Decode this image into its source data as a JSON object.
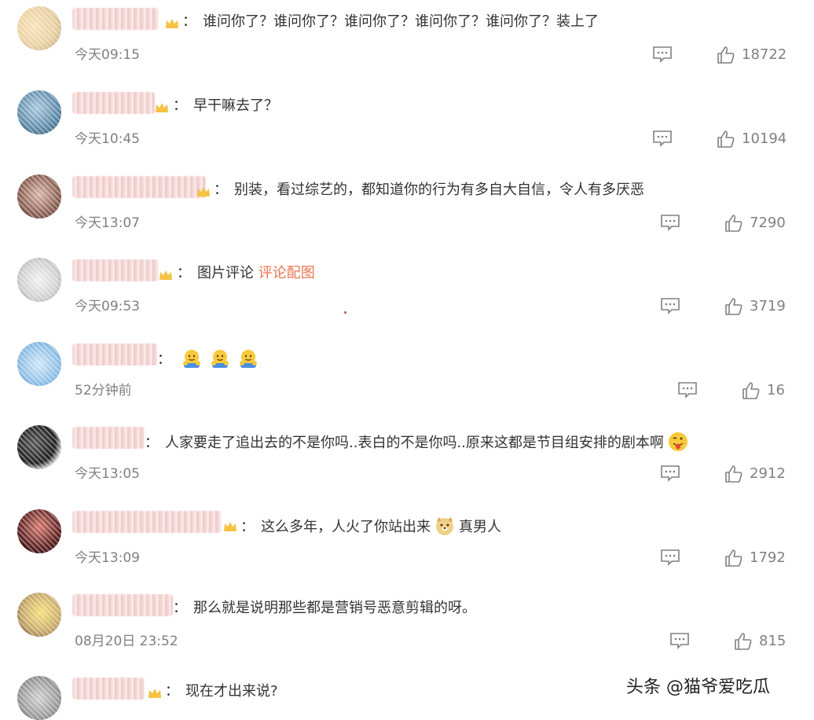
{
  "comments": [
    {
      "text": "谁问你了？谁问你了？谁问你了？谁问你了？谁问你了？装上了",
      "time": "今天09:15",
      "likes": "18722"
    },
    {
      "text": "早干嘛去了？",
      "time": "今天10:45",
      "likes": "10194"
    },
    {
      "text": "别装，看过综艺的，都知道你的行为有多自大自信，令人有多厌恶",
      "time": "今天13:07",
      "likes": "7290"
    },
    {
      "text": "图片评论",
      "link": "评论配图",
      "time": "今天09:53",
      "likes": "3719"
    },
    {
      "text": "",
      "emoji": [
        "hugging-emoji",
        "hugging-emoji",
        "hugging-emoji"
      ],
      "time": "52分钟前",
      "likes": "16"
    },
    {
      "text": "人家要走了追出去的不是你吗..表白的不是你吗..原来这都是节目组安排的剧本啊",
      "emoji": [
        "tongue-wink-emoji"
      ],
      "time": "今天13:05",
      "likes": "2912"
    },
    {
      "text": "这么多年，人火了你站出来",
      "emoji": [
        "doge-emoji"
      ],
      "text2": "真男人",
      "time": "今天13:09",
      "likes": "1792"
    },
    {
      "text": "那么就是说明那些都是营销号恶意剪辑的呀。",
      "time": "08月20日 23:52",
      "likes": "815"
    },
    {
      "text": "现在才出来说?",
      "time": "",
      "likes": ""
    }
  ],
  "colon": "：",
  "watermark": "头条 @猫爷爱吃瓜",
  "colors": {
    "text": "#333333",
    "meta": "#808080",
    "link": "#eb7350"
  }
}
